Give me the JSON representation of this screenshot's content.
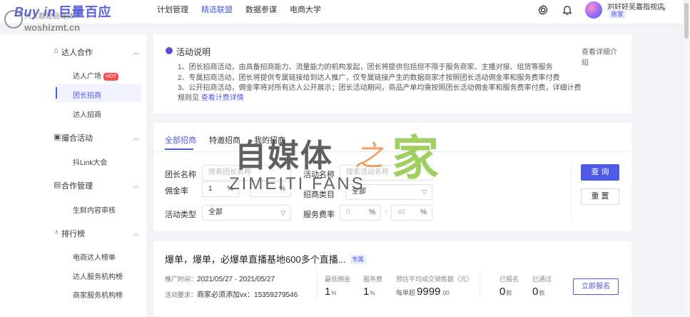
{
  "brand": {
    "logo_en": "Buy in",
    "logo_cn": "巨量百应",
    "accent": "#4e59e5"
  },
  "watermark_top": {
    "line1": "人人都是自媒体",
    "line2": "woshizmt.cn"
  },
  "watermark_center": {
    "cn": "自媒体",
    "zhi": "之",
    "jia": "家",
    "en": "ZIMEITI FANS"
  },
  "nav": {
    "items": [
      "计划管理",
      "精选联盟",
      "数据参谋",
      "电商大学"
    ],
    "active_index": 1
  },
  "user": {
    "name": "刘好好吴嘉指视店",
    "role": "商家"
  },
  "icons": {
    "settings": "gear-icon",
    "notifications": "bell-icon"
  },
  "sidebar": {
    "groups": [
      {
        "label": "达人合作",
        "icon": "home-icon",
        "items": [
          {
            "label": "达人广场",
            "badge": "HOT"
          },
          {
            "label": "团长招商",
            "active": true
          },
          {
            "label": "达人招商"
          }
        ]
      },
      {
        "label": "撮合活动",
        "icon": "activity-icon",
        "items": [
          {
            "label": "抖Link大会"
          }
        ]
      },
      {
        "label": "合作管理",
        "icon": "manage-icon",
        "items": [
          {
            "label": "生鲜内容审核"
          }
        ]
      },
      {
        "label": "排行榜",
        "icon": "ranking-icon",
        "items": [
          {
            "label": "电商达人榜单"
          },
          {
            "label": "达人服务机构榜"
          },
          {
            "label": "商家服务机构榜"
          }
        ]
      }
    ]
  },
  "notice": {
    "title": "活动说明",
    "lines": [
      "1、团长招商活动，由具备招商能力、流量能力的机构发起，团长将提供包括但不限于服务商家、主播对接、组货等服务",
      "2、专属招商活动，团长将提供专属链接给到达人推广，仅专属链接产生的数据商家才按照团长活动佣金率和服务费率付费",
      "3、公开招商活动，佣金率将对所有达人公开展示；团长活动期间，商品产单均需按照团长活动佣金率和服务费率付费，详细计费",
      "规则见"
    ],
    "billing_link": "查看计费详情",
    "detail_link": "查看详细介绍"
  },
  "tabs": [
    "全部招商",
    "特邀招商",
    "我的招商"
  ],
  "filters": {
    "leader_name": {
      "label": "团长名称",
      "placeholder": "搜索团长名称"
    },
    "activity_name": {
      "label": "活动名称",
      "placeholder": "搜索活动名称"
    },
    "commission": {
      "label": "佣金率",
      "min": "1",
      "max": "",
      "unit": "%"
    },
    "main_category": {
      "label": "招商类目",
      "value": "全部"
    },
    "activity_type": {
      "label": "活动类型",
      "value": "全部"
    },
    "service_fee": {
      "label": "服务费率",
      "min": "0",
      "max": "40",
      "unit": "%"
    },
    "search_btn": "查 询",
    "reset_btn": "重 置"
  },
  "card": {
    "title": "爆单，爆单，必爆单直播基地600多个直播...",
    "tag": "专属",
    "period_label": "推广时间：",
    "period": "2021/05/27 - 2021/05/27",
    "requirement_label": "活动要求：",
    "requirement": "商家必须添加vx：15359279546",
    "stats": [
      {
        "label": "最低佣金",
        "value": "1",
        "unit": "%"
      },
      {
        "label": "服务费",
        "value": "1",
        "unit": "%"
      },
      {
        "label": "预估平均成交销售额（元）",
        "prefix": "每单超",
        "value": "9999",
        "unit": ".00"
      },
      {
        "label": "已报名",
        "value": "0",
        "unit": "款"
      },
      {
        "label": "已通过",
        "value": "0",
        "unit": "款"
      }
    ],
    "apply_btn": "立即报名"
  }
}
